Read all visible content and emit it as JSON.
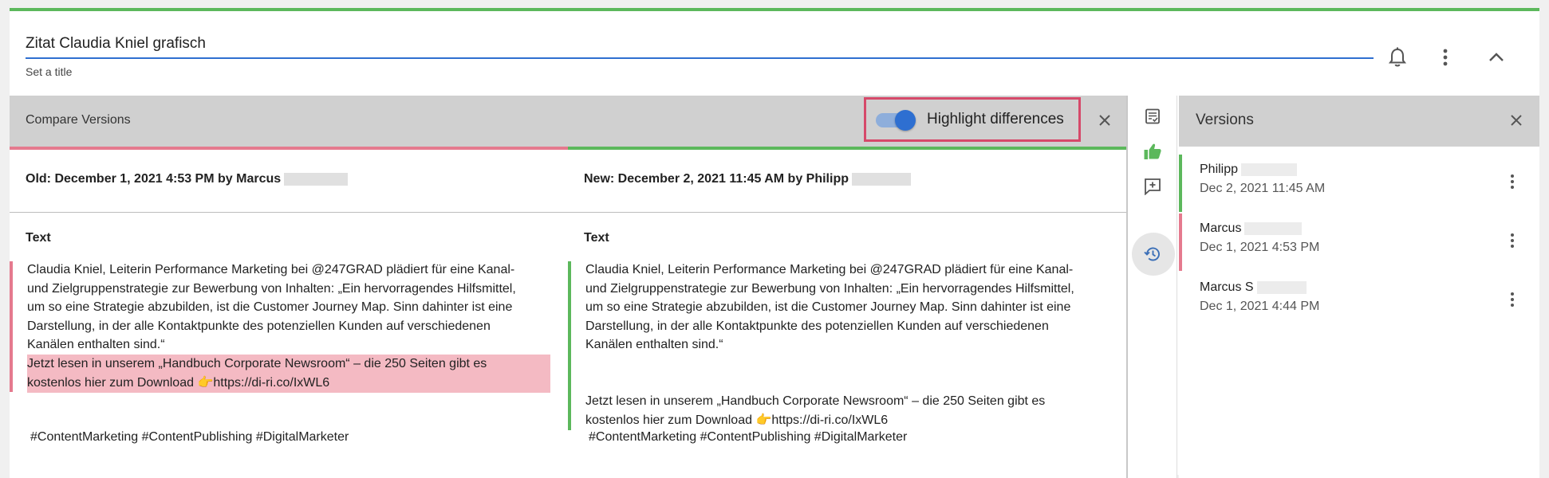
{
  "header": {
    "title_value": "Zitat Claudia Kniel grafisch",
    "title_helper": "Set a title"
  },
  "compare": {
    "title": "Compare Versions",
    "highlight_label": "Highlight differences",
    "highlight_enabled": true,
    "old_header": "Old: December 1, 2021 4:53 PM by Marcus",
    "new_header": "New: December 2, 2021 11:45 AM by Philipp",
    "old": {
      "text_label": "Text",
      "para1": [
        "Claudia Kniel, Leiterin Performance Marketing bei @247GRAD plädiert für eine Kanal-",
        "und Zielgruppenstrategie zur Bewerbung von Inhalten: „Ein hervorragendes Hilfsmittel,",
        "um so eine Strategie abzubilden, ist die Customer Journey Map. Sinn dahinter ist eine",
        "Darstellung, in der alle Kontaktpunkte des potenziellen Kunden auf verschiedenen",
        "Kanälen enthalten sind.“"
      ],
      "para2": [
        "Jetzt lesen in unserem „Handbuch Corporate Newsroom“ – die 250 Seiten gibt es",
        "kostenlos hier zum Download 👉https://di-ri.co/IxWL6"
      ],
      "tags": "#ContentMarketing #ContentPublishing #DigitalMarketer"
    },
    "new": {
      "text_label": "Text",
      "para1": [
        "Claudia Kniel, Leiterin Performance Marketing bei @247GRAD plädiert für eine Kanal-",
        "und Zielgruppenstrategie zur Bewerbung von Inhalten: „Ein hervorragendes Hilfsmittel,",
        "um so eine Strategie abzubilden, ist die Customer Journey Map. Sinn dahinter ist eine",
        "Darstellung, in der alle Kontaktpunkte des potenziellen Kunden auf verschiedenen",
        "Kanälen enthalten sind.“"
      ],
      "para2": [
        "Jetzt lesen in unserem „Handbuch Corporate Newsroom“ – die 250 Seiten gibt es",
        "kostenlos hier zum Download 👉https://di-ri.co/IxWL6"
      ],
      "tags": "#ContentMarketing #ContentPublishing #DigitalMarketer"
    }
  },
  "rail": {
    "icons": [
      "checklist-icon",
      "thumbs-up-icon",
      "add-comment-icon",
      "history-icon"
    ],
    "active": "history-icon"
  },
  "versions": {
    "title": "Versions",
    "items": [
      {
        "name": "Philipp",
        "date": "Dec 2, 2021 11:45 AM",
        "status_color": "#5cb85c"
      },
      {
        "name": "Marcus",
        "date": "Dec 1, 2021 4:53 PM",
        "status_color": "#e57a8e"
      },
      {
        "name": "Marcus S",
        "date": "Dec 1, 2021 4:44 PM",
        "status_color": ""
      }
    ]
  },
  "colors": {
    "accent": "#2e6fd1",
    "added": "#5cb85c",
    "removed": "#e57a8e",
    "removed_bg": "#f4bac3",
    "highlight_box": "#d6496a"
  }
}
